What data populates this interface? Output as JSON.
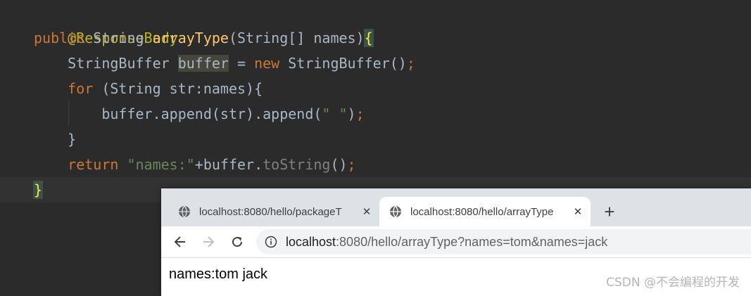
{
  "code": {
    "line1": {
      "annotation": "@ResponseBody"
    },
    "line2": {
      "kw": "public",
      "type": "String",
      "method": "arrayType",
      "params": "(String[] names)",
      "brace": "{"
    },
    "line3": {
      "type": "StringBuffer",
      "var": "buffer",
      "assign": " = ",
      "kw": "new",
      "ctor": " StringBuffer()",
      "semi": ";"
    },
    "line4": {
      "kw": "for",
      "rest": " (String str:names){"
    },
    "line5": {
      "call": "buffer.append(str).append(",
      "str": "\" \"",
      "close": ")",
      "semi": ";"
    },
    "line6": {
      "text": "}"
    },
    "line7": {
      "kw": "return",
      "str": "\"names:\"",
      "rest": "+buffer.",
      "dim": "toString",
      "close": "()",
      "semi": ";"
    },
    "line8": {
      "brace": "}"
    }
  },
  "browser": {
    "tabs": [
      {
        "title": "localhost:8080/hello/packageT",
        "close": "✕",
        "active": false
      },
      {
        "title": "localhost:8080/hello/arrayType",
        "close": "✕",
        "active": true
      }
    ],
    "new_tab": "+",
    "url_host": "localhost",
    "url_rest": ":8080/hello/arrayType?names=tom&names=jack",
    "page_body": "names:tom jack"
  },
  "watermark": "CSDN @不会编程的开发",
  "icons": [
    "globe-icon",
    "close-icon",
    "plus-icon",
    "back-arrow-icon",
    "forward-arrow-icon",
    "reload-icon",
    "info-icon"
  ],
  "colors": {
    "editor_bg": "#2b2b2b",
    "keyword": "#cc7832",
    "method": "#ffc66d",
    "string": "#6a8759",
    "annotation": "#bbb529",
    "tabstrip": "#dee1e6"
  }
}
